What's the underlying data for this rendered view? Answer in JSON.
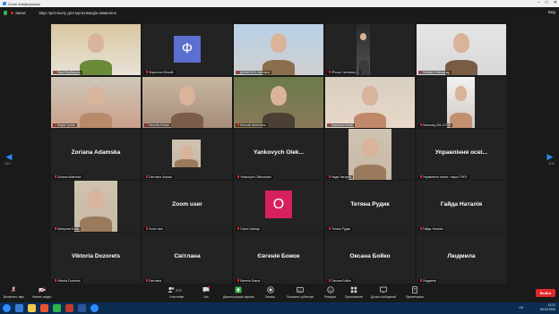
{
  "window": {
    "title": "Zoom Конференція"
  },
  "topbar": {
    "record_label": "Запис",
    "status_text": "Звук протоколу для мультимедіа вимкнено",
    "view_label": "Вид"
  },
  "participants": [
    {
      "name": "Зоря Вербицька",
      "big": "",
      "kind": "video",
      "active": true
    },
    {
      "name": "Форостюк Віталій",
      "big": "",
      "kind": "avatar-phi"
    },
    {
      "name": "ДИВАНЧУК Світлана",
      "big": "",
      "kind": "video"
    },
    {
      "name": "iPhone Світлана (2)",
      "big": "",
      "kind": "video"
    },
    {
      "name": "Зінович Олександр",
      "big": "",
      "kind": "video"
    },
    {
      "name": "Марія Цолик",
      "big": "",
      "kind": "video"
    },
    {
      "name": "Наталія Косюк",
      "big": "",
      "kind": "video"
    },
    {
      "name": "Наталія Шевченко",
      "big": "",
      "kind": "video"
    },
    {
      "name": "Катерина Білик",
      "big": "",
      "kind": "video"
    },
    {
      "name": "Samsung SM-A7018",
      "big": "",
      "kind": "video"
    },
    {
      "name": "Zoriana Adamska",
      "big": "Zoriana Adamska",
      "kind": "text"
    },
    {
      "name": "Світлана Черкас",
      "big": "",
      "kind": "video-small"
    },
    {
      "name": "Yankovych Oleksandra",
      "big": "Yankovych Olek...",
      "kind": "text"
    },
    {
      "name": "Надя Нагорна",
      "big": "",
      "kind": "video"
    },
    {
      "name": "Управління освіти і науки ТНПУ",
      "big": "Управління осві...",
      "kind": "text"
    },
    {
      "name": "Катерина Білик",
      "big": "",
      "kind": "video"
    },
    {
      "name": "Zoom user",
      "big": "Zoom user",
      "kind": "text"
    },
    {
      "name": "Ольга Шевчук",
      "big": "",
      "kind": "avatar-o"
    },
    {
      "name": "Тетяна Рудик",
      "big": "Тетяна Рудик",
      "kind": "text"
    },
    {
      "name": "Гайда Наталія",
      "big": "Гайда Наталія",
      "kind": "text"
    },
    {
      "name": "Viktoria Dozorets",
      "big": "Viktoria Dozorets",
      "kind": "text"
    },
    {
      "name": "Світлана",
      "big": "Світлана",
      "kind": "text"
    },
    {
      "name": "Євгенія Божок",
      "big": "Євгенія Божок",
      "kind": "text"
    },
    {
      "name": "Оксана Бойко",
      "big": "Оксана Бойко",
      "kind": "text"
    },
    {
      "name": "Людмила",
      "big": "Людмила",
      "kind": "text"
    }
  ],
  "avatars": {
    "phi": "Ф",
    "o": "О"
  },
  "pager": {
    "left": "1/11",
    "right": "1/11"
  },
  "toolbar": {
    "mic": "Включить звук",
    "video": "Начать видео",
    "participants": "Участники",
    "participants_count": "272",
    "chat": "Чат",
    "share": "Демонстрация экрана",
    "record": "Запись",
    "subtitles": "Показать субтитры",
    "reactions": "Реакции",
    "apps": "Приложения",
    "whiteboard": "Доска сообщений",
    "notes": "Примечания",
    "end": "Выйти"
  },
  "taskbar": {
    "lang": "UK",
    "time": "13:21",
    "date": "05.03.2026"
  },
  "colors": {
    "accent": "#2d8cff",
    "active_border": "#c8e02a",
    "end": "#e02828",
    "share": "#3bb34a"
  }
}
